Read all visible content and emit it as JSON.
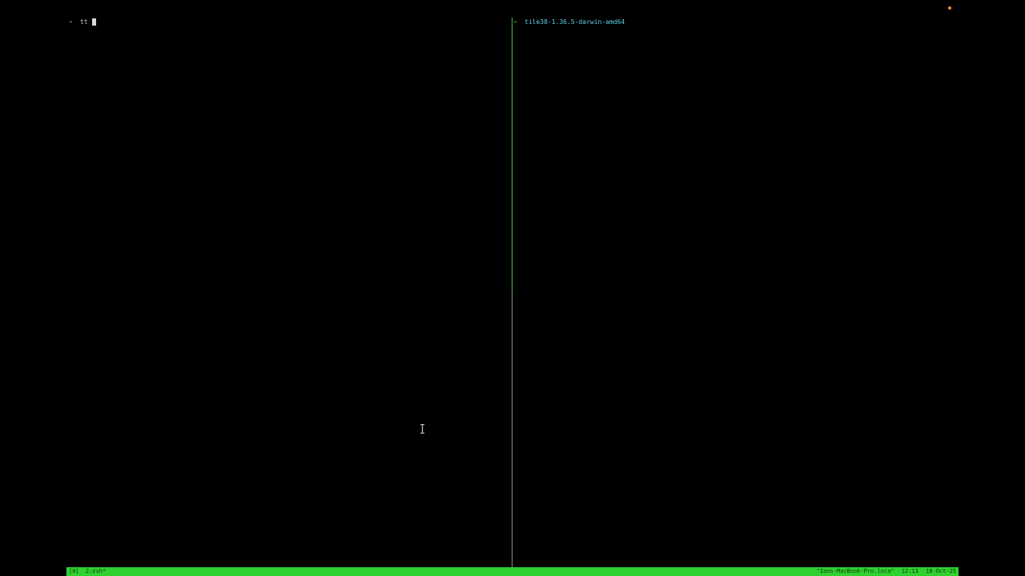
{
  "left_pane": {
    "prompt_symbol": "→",
    "command": "tt"
  },
  "right_pane": {
    "prompt_symbol": "→",
    "command": "tile38-1.36.5-darwin-amd64"
  },
  "status_bar": {
    "session": "[0]",
    "window": "2:zsh*",
    "hostname": "\"Ians-MacBook-Pro.loca\"",
    "time": "12:13",
    "date": "18-Oct-25"
  },
  "colors": {
    "background": "#000000",
    "status_bar": "#2fd12f",
    "prompt_arrow": "#3ecf3e",
    "right_command": "#5fd0e6",
    "activity_dot": "#f0901e"
  }
}
